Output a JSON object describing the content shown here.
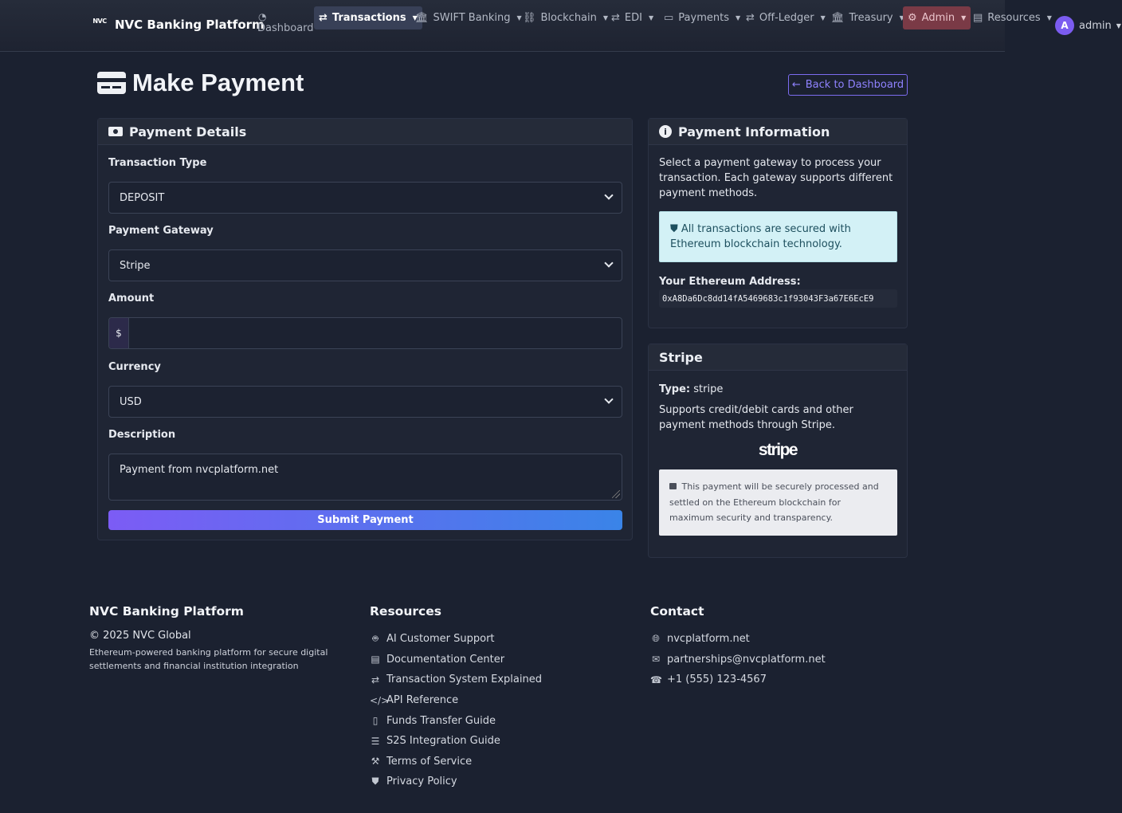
{
  "nav": {
    "brand_logo": "NVC",
    "brand": "NVC Banking Platform",
    "dashboard": "Dashboard",
    "items": [
      {
        "label": "Transactions",
        "icon": "arrows-exchange-icon"
      },
      {
        "label": "SWIFT Banking",
        "icon": "bank-icon"
      },
      {
        "label": "Blockchain",
        "icon": "link-icon"
      },
      {
        "label": "EDI",
        "icon": "arrows-exchange-icon"
      },
      {
        "label": "Payments",
        "icon": "credit-card-icon"
      },
      {
        "label": "Off-Ledger",
        "icon": "arrows-exchange-icon"
      },
      {
        "label": "Treasury",
        "icon": "bank-icon"
      },
      {
        "label": "Admin",
        "icon": "gear-icon"
      },
      {
        "label": "Resources",
        "icon": "book-icon"
      }
    ],
    "user_initial": "A",
    "user_name": "admin"
  },
  "page": {
    "title": "Make Payment",
    "back_label": "Back to Dashboard"
  },
  "payment_form": {
    "header": "Payment Details",
    "transaction_type_label": "Transaction Type",
    "transaction_type_value": "DEPOSIT",
    "gateway_label": "Payment Gateway",
    "gateway_value": "Stripe",
    "amount_label": "Amount",
    "amount_prefix": "$",
    "amount_value": "",
    "currency_label": "Currency",
    "currency_value": "USD",
    "description_label": "Description",
    "description_value": "Payment from nvcplatform.net",
    "submit_label": "Submit Payment"
  },
  "payment_info": {
    "header": "Payment Information",
    "intro": "Select a payment gateway to process your transaction. Each gateway supports different payment methods.",
    "alert": "All transactions are secured with Ethereum blockchain technology.",
    "eth_label": "Your Ethereum Address:",
    "eth_address": "0xA8Da6Dc8dd14fA5469683c1f93043F3a67E6EcE9"
  },
  "gateway_card": {
    "header": "Stripe",
    "type_label": "Type:",
    "type_value": "stripe",
    "description": "Supports credit/debit cards and other payment methods through Stripe.",
    "logo_text": "stripe",
    "note": "This payment will be securely processed and settled on the Ethereum blockchain for maximum security and transparency."
  },
  "footer": {
    "brand": "NVC Banking Platform",
    "copyright": "© 2025 NVC Global",
    "tagline": "Ethereum-powered banking platform for secure digital settlements and financial institution integration",
    "resources_title": "Resources",
    "resources": [
      {
        "label": "AI Customer Support",
        "icon": "robot-icon"
      },
      {
        "label": "Documentation Center",
        "icon": "book-icon"
      },
      {
        "label": "Transaction System Explained",
        "icon": "arrows-exchange-icon"
      },
      {
        "label": "API Reference",
        "icon": "code-icon"
      },
      {
        "label": "Funds Transfer Guide",
        "icon": "pdf-file-icon"
      },
      {
        "label": "S2S Integration Guide",
        "icon": "server-icon"
      },
      {
        "label": "Terms of Service",
        "icon": "gavel-icon"
      },
      {
        "label": "Privacy Policy",
        "icon": "shield-icon"
      }
    ],
    "contact_title": "Contact",
    "contact": [
      {
        "label": "nvcplatform.net",
        "icon": "globe-icon"
      },
      {
        "label": "partnerships@nvcplatform.net",
        "icon": "envelope-icon"
      },
      {
        "label": "+1 (555) 123-4567",
        "icon": "phone-icon"
      }
    ]
  }
}
